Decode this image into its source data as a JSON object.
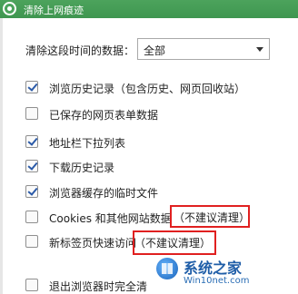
{
  "window": {
    "title": "清除上网痕迹"
  },
  "time_range": {
    "label": "清除这段时间的数据：",
    "selected": "全部"
  },
  "options": [
    {
      "label": "浏览历史记录（包含历史、网页回收站）",
      "checked": true
    },
    {
      "label": "已保存的网页表单数据",
      "checked": false
    },
    {
      "label": "地址栏下拉列表",
      "checked": true
    },
    {
      "label": "下载历史记录",
      "checked": true
    },
    {
      "label": "浏览器缓存的临时文件",
      "checked": true
    },
    {
      "label": "Cookies 和其他网站数据",
      "checked": false,
      "annotation": "（不建议清理）"
    },
    {
      "label": "新标签页快速访问",
      "checked": false,
      "annotation": "（不建议清理）"
    },
    {
      "label": "退出浏览器时完全清",
      "checked": false
    }
  ],
  "watermark": {
    "title": "系统之家",
    "url": "Win10net.com"
  },
  "colors": {
    "titlebar": "#4ca35c",
    "highlight": "#e02020",
    "check": "#2b5aa8"
  }
}
